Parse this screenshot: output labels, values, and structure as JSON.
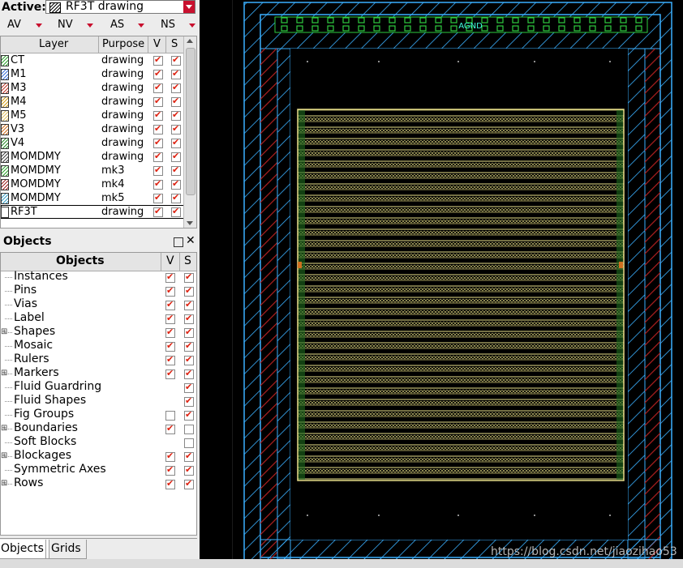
{
  "layer_panel": {
    "active_label": "Active:",
    "active_layer": "RF3T drawing",
    "visibility_buttons": [
      "AV",
      "NV",
      "AS",
      "NS"
    ],
    "columns": {
      "layer": "Layer",
      "purpose": "Purpose",
      "v": "V",
      "s": "S"
    },
    "layers": [
      {
        "name": "CT",
        "purpose": "drawing",
        "v": true,
        "s": true,
        "color": "#2fa32f"
      },
      {
        "name": "M1",
        "purpose": "drawing",
        "v": true,
        "s": true,
        "color": "#3a6fd8"
      },
      {
        "name": "M3",
        "purpose": "drawing",
        "v": true,
        "s": true,
        "color": "#c0392b"
      },
      {
        "name": "M4",
        "purpose": "drawing",
        "v": true,
        "s": true,
        "color": "#d4a017"
      },
      {
        "name": "M5",
        "purpose": "drawing",
        "v": true,
        "s": true,
        "color": "#e0c060"
      },
      {
        "name": "V3",
        "purpose": "drawing",
        "v": true,
        "s": true,
        "color": "#d07020"
      },
      {
        "name": "V4",
        "purpose": "drawing",
        "v": true,
        "s": true,
        "color": "#2a8a2a"
      },
      {
        "name": "MOMDMY",
        "purpose": "drawing",
        "v": true,
        "s": true,
        "color": "#444444"
      },
      {
        "name": "MOMDMY",
        "purpose": "mk3",
        "v": true,
        "s": true,
        "color": "#2fa32f"
      },
      {
        "name": "MOMDMY",
        "purpose": "mk4",
        "v": true,
        "s": true,
        "color": "#a02020"
      },
      {
        "name": "MOMDMY",
        "purpose": "mk5",
        "v": true,
        "s": true,
        "color": "#3aa0c8"
      },
      {
        "name": "RF3T",
        "purpose": "drawing",
        "v": true,
        "s": true,
        "color": "#ffffff"
      }
    ]
  },
  "objects_panel": {
    "title": "Objects",
    "columns": {
      "objects": "Objects",
      "v": "V",
      "s": "S"
    },
    "items": [
      {
        "name": "Instances",
        "expandable": false,
        "v": true,
        "s": true
      },
      {
        "name": "Pins",
        "expandable": false,
        "v": true,
        "s": true
      },
      {
        "name": "Vias",
        "expandable": false,
        "v": true,
        "s": true
      },
      {
        "name": "Label",
        "expandable": false,
        "v": true,
        "s": true
      },
      {
        "name": "Shapes",
        "expandable": true,
        "v": true,
        "s": true
      },
      {
        "name": "Mosaic",
        "expandable": false,
        "v": true,
        "s": true
      },
      {
        "name": "Rulers",
        "expandable": false,
        "v": true,
        "s": true
      },
      {
        "name": "Markers",
        "expandable": true,
        "v": true,
        "s": true
      },
      {
        "name": "Fluid Guardring",
        "expandable": false,
        "v": null,
        "s": true
      },
      {
        "name": "Fluid Shapes",
        "expandable": false,
        "v": null,
        "s": true
      },
      {
        "name": "Fig Groups",
        "expandable": false,
        "v": false,
        "s": true
      },
      {
        "name": "Boundaries",
        "expandable": true,
        "v": true,
        "s": false
      },
      {
        "name": "Soft Blocks",
        "expandable": false,
        "v": null,
        "s": false
      },
      {
        "name": "Blockages",
        "expandable": true,
        "v": true,
        "s": true
      },
      {
        "name": "Symmetric Axes",
        "expandable": false,
        "v": true,
        "s": true
      },
      {
        "name": "Rows",
        "expandable": true,
        "v": true,
        "s": true
      }
    ],
    "tabs": [
      "Objects",
      "Grids"
    ]
  },
  "canvas": {
    "pin_label": "AGND",
    "colors": {
      "background": "#000000",
      "blue": "#3ab0ff",
      "red": "#a01818",
      "yellow": "#f0e68c",
      "green": "#2ecc40",
      "cyan": "#40ffe0"
    }
  },
  "watermark": "https://blog.csdn.net/jiaozihao53"
}
